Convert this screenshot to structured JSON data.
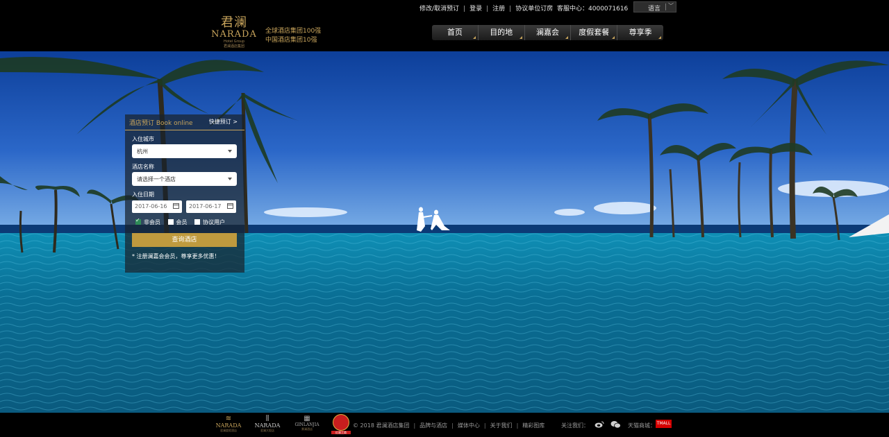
{
  "topbar": {
    "links": [
      "修改/取消预订",
      "登录",
      "注册",
      "协议单位订房"
    ],
    "hotline_label": "客服中心：",
    "hotline_number": "4000071616",
    "language_label": "语言"
  },
  "header": {
    "logo_mark": "君澜",
    "logo_brand": "NARADA",
    "logo_sub_en": "Hotel Group",
    "logo_sub_cn": "君澜酒店集团",
    "tagline_1": "全球酒店集团100强",
    "tagline_2": "中国酒店集团10强"
  },
  "nav": {
    "items": [
      "首页",
      "目的地",
      "澜嘉会",
      "度假套餐",
      "尊享季"
    ]
  },
  "booking": {
    "title": "酒店预订 Book online",
    "quick_link": "快捷预订 >",
    "city_label": "入住城市",
    "city_value": "杭州",
    "hotel_label": "酒店名称",
    "hotel_placeholder": "请选择一个酒店",
    "date_label": "入住日期",
    "checkin": "2017-06-16",
    "checkout": "2017-06-17",
    "member_options": [
      "非会员",
      "会员",
      "协议用户"
    ],
    "selected_option": "非会员",
    "search_button": "查询酒店",
    "register_note": "* 注册澜嘉会会员，尊享更多优惠！"
  },
  "footer": {
    "logos": [
      {
        "name": "NARADA",
        "sub": "君澜度假酒店"
      },
      {
        "name": "NARADA",
        "sub": "君澜大饭店"
      },
      {
        "name": "GINLANJIA",
        "sub": "景澜酒店"
      }
    ],
    "emblem_caption": "红盾工商",
    "copyright": "© 2018  君澜酒店集团",
    "links": [
      "品牌与酒店",
      "媒体中心",
      "关于我们",
      "精彩图库"
    ],
    "follow_label": "关注我们：",
    "tmall_label": "天猫商城：",
    "tmall_badge": "TMALL"
  },
  "colors": {
    "accent_gold": "#c9a55c",
    "button_gold": "#bf9a3e",
    "bar_black": "#000000"
  }
}
